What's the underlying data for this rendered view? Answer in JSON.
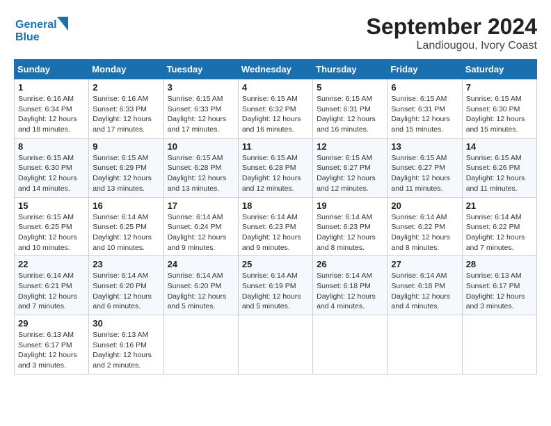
{
  "logo": {
    "line1": "General",
    "line2": "Blue"
  },
  "title": "September 2024",
  "location": "Landiougou, Ivory Coast",
  "days_of_week": [
    "Sunday",
    "Monday",
    "Tuesday",
    "Wednesday",
    "Thursday",
    "Friday",
    "Saturday"
  ],
  "weeks": [
    [
      {
        "day": 1,
        "info": "Sunrise: 6:16 AM\nSunset: 6:34 PM\nDaylight: 12 hours\nand 18 minutes."
      },
      {
        "day": 2,
        "info": "Sunrise: 6:16 AM\nSunset: 6:33 PM\nDaylight: 12 hours\nand 17 minutes."
      },
      {
        "day": 3,
        "info": "Sunrise: 6:15 AM\nSunset: 6:33 PM\nDaylight: 12 hours\nand 17 minutes."
      },
      {
        "day": 4,
        "info": "Sunrise: 6:15 AM\nSunset: 6:32 PM\nDaylight: 12 hours\nand 16 minutes."
      },
      {
        "day": 5,
        "info": "Sunrise: 6:15 AM\nSunset: 6:31 PM\nDaylight: 12 hours\nand 16 minutes."
      },
      {
        "day": 6,
        "info": "Sunrise: 6:15 AM\nSunset: 6:31 PM\nDaylight: 12 hours\nand 15 minutes."
      },
      {
        "day": 7,
        "info": "Sunrise: 6:15 AM\nSunset: 6:30 PM\nDaylight: 12 hours\nand 15 minutes."
      }
    ],
    [
      {
        "day": 8,
        "info": "Sunrise: 6:15 AM\nSunset: 6:30 PM\nDaylight: 12 hours\nand 14 minutes."
      },
      {
        "day": 9,
        "info": "Sunrise: 6:15 AM\nSunset: 6:29 PM\nDaylight: 12 hours\nand 13 minutes."
      },
      {
        "day": 10,
        "info": "Sunrise: 6:15 AM\nSunset: 6:28 PM\nDaylight: 12 hours\nand 13 minutes."
      },
      {
        "day": 11,
        "info": "Sunrise: 6:15 AM\nSunset: 6:28 PM\nDaylight: 12 hours\nand 12 minutes."
      },
      {
        "day": 12,
        "info": "Sunrise: 6:15 AM\nSunset: 6:27 PM\nDaylight: 12 hours\nand 12 minutes."
      },
      {
        "day": 13,
        "info": "Sunrise: 6:15 AM\nSunset: 6:27 PM\nDaylight: 12 hours\nand 11 minutes."
      },
      {
        "day": 14,
        "info": "Sunrise: 6:15 AM\nSunset: 6:26 PM\nDaylight: 12 hours\nand 11 minutes."
      }
    ],
    [
      {
        "day": 15,
        "info": "Sunrise: 6:15 AM\nSunset: 6:25 PM\nDaylight: 12 hours\nand 10 minutes."
      },
      {
        "day": 16,
        "info": "Sunrise: 6:14 AM\nSunset: 6:25 PM\nDaylight: 12 hours\nand 10 minutes."
      },
      {
        "day": 17,
        "info": "Sunrise: 6:14 AM\nSunset: 6:24 PM\nDaylight: 12 hours\nand 9 minutes."
      },
      {
        "day": 18,
        "info": "Sunrise: 6:14 AM\nSunset: 6:23 PM\nDaylight: 12 hours\nand 9 minutes."
      },
      {
        "day": 19,
        "info": "Sunrise: 6:14 AM\nSunset: 6:23 PM\nDaylight: 12 hours\nand 8 minutes."
      },
      {
        "day": 20,
        "info": "Sunrise: 6:14 AM\nSunset: 6:22 PM\nDaylight: 12 hours\nand 8 minutes."
      },
      {
        "day": 21,
        "info": "Sunrise: 6:14 AM\nSunset: 6:22 PM\nDaylight: 12 hours\nand 7 minutes."
      }
    ],
    [
      {
        "day": 22,
        "info": "Sunrise: 6:14 AM\nSunset: 6:21 PM\nDaylight: 12 hours\nand 7 minutes."
      },
      {
        "day": 23,
        "info": "Sunrise: 6:14 AM\nSunset: 6:20 PM\nDaylight: 12 hours\nand 6 minutes."
      },
      {
        "day": 24,
        "info": "Sunrise: 6:14 AM\nSunset: 6:20 PM\nDaylight: 12 hours\nand 5 minutes."
      },
      {
        "day": 25,
        "info": "Sunrise: 6:14 AM\nSunset: 6:19 PM\nDaylight: 12 hours\nand 5 minutes."
      },
      {
        "day": 26,
        "info": "Sunrise: 6:14 AM\nSunset: 6:18 PM\nDaylight: 12 hours\nand 4 minutes."
      },
      {
        "day": 27,
        "info": "Sunrise: 6:14 AM\nSunset: 6:18 PM\nDaylight: 12 hours\nand 4 minutes."
      },
      {
        "day": 28,
        "info": "Sunrise: 6:13 AM\nSunset: 6:17 PM\nDaylight: 12 hours\nand 3 minutes."
      }
    ],
    [
      {
        "day": 29,
        "info": "Sunrise: 6:13 AM\nSunset: 6:17 PM\nDaylight: 12 hours\nand 3 minutes."
      },
      {
        "day": 30,
        "info": "Sunrise: 6:13 AM\nSunset: 6:16 PM\nDaylight: 12 hours\nand 2 minutes."
      },
      null,
      null,
      null,
      null,
      null
    ]
  ]
}
